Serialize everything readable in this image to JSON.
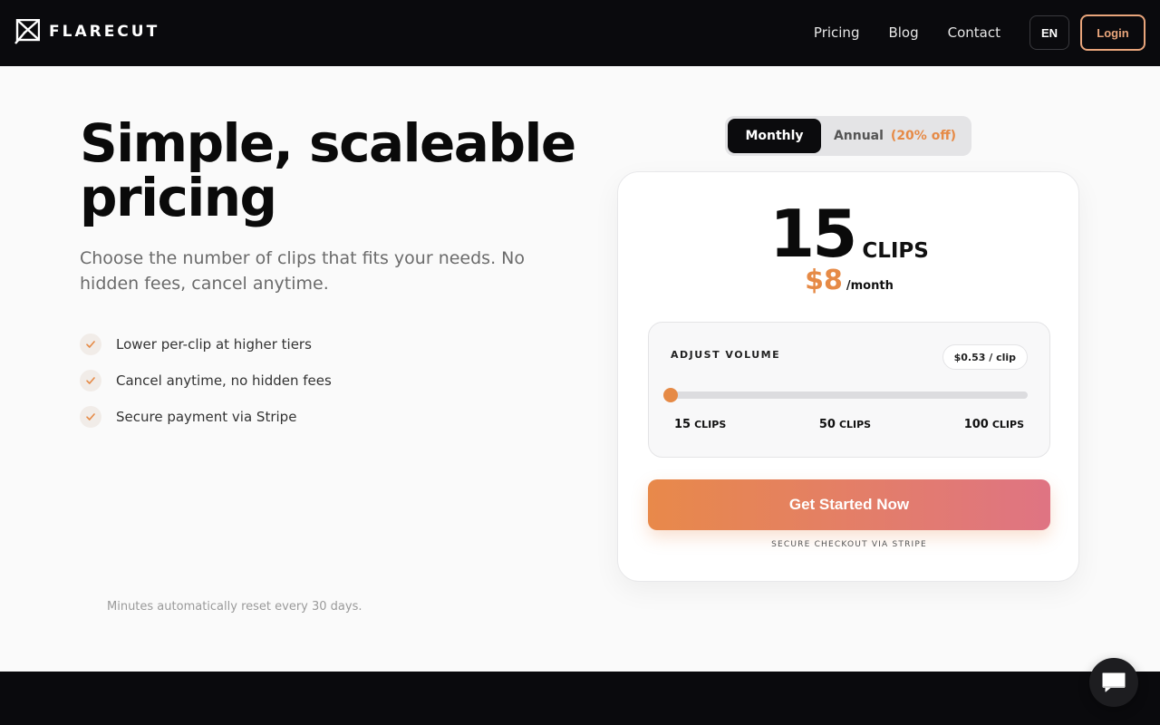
{
  "brand": {
    "name": "FLARECUT",
    "logo_icon": "flare-logo-icon"
  },
  "nav": {
    "links": [
      "Pricing",
      "Blog",
      "Contact"
    ],
    "language": "EN",
    "login": "Login"
  },
  "hero": {
    "title_line1": "Simple, scaleable",
    "title_line2": "pricing",
    "subtitle": "Choose the number of clips that fits your needs. No hidden fees, cancel anytime.",
    "features": [
      "Lower per-clip at higher tiers",
      "Cancel anytime, no hidden fees",
      "Secure payment via Stripe"
    ],
    "footnote": "Minutes automatically reset every 30 days."
  },
  "billing_toggle": {
    "monthly": "Monthly",
    "annual": "Annual",
    "annual_discount": "(20% off)",
    "selected": "Monthly"
  },
  "plan": {
    "clip_count": "15",
    "clip_unit": "CLIPS",
    "price": "$8",
    "period": "/month",
    "volume_label": "ADJUST VOLUME",
    "per_clip": "$0.53 / clip",
    "slider": {
      "min": 15,
      "max": 100,
      "value": 15
    },
    "ticks": [
      {
        "value": "15",
        "unit": "CLIPS"
      },
      {
        "value": "50",
        "unit": "CLIPS"
      },
      {
        "value": "100",
        "unit": "CLIPS"
      }
    ],
    "cta": "Get Started Now",
    "secure_note": "SECURE CHECKOUT VIA STRIPE"
  },
  "colors": {
    "accent": "#e68a46",
    "accent_end": "#df7483",
    "dark": "#0a0a0d",
    "login_border": "#e9a57b"
  },
  "chat": {
    "icon": "chat-bubble-icon"
  }
}
